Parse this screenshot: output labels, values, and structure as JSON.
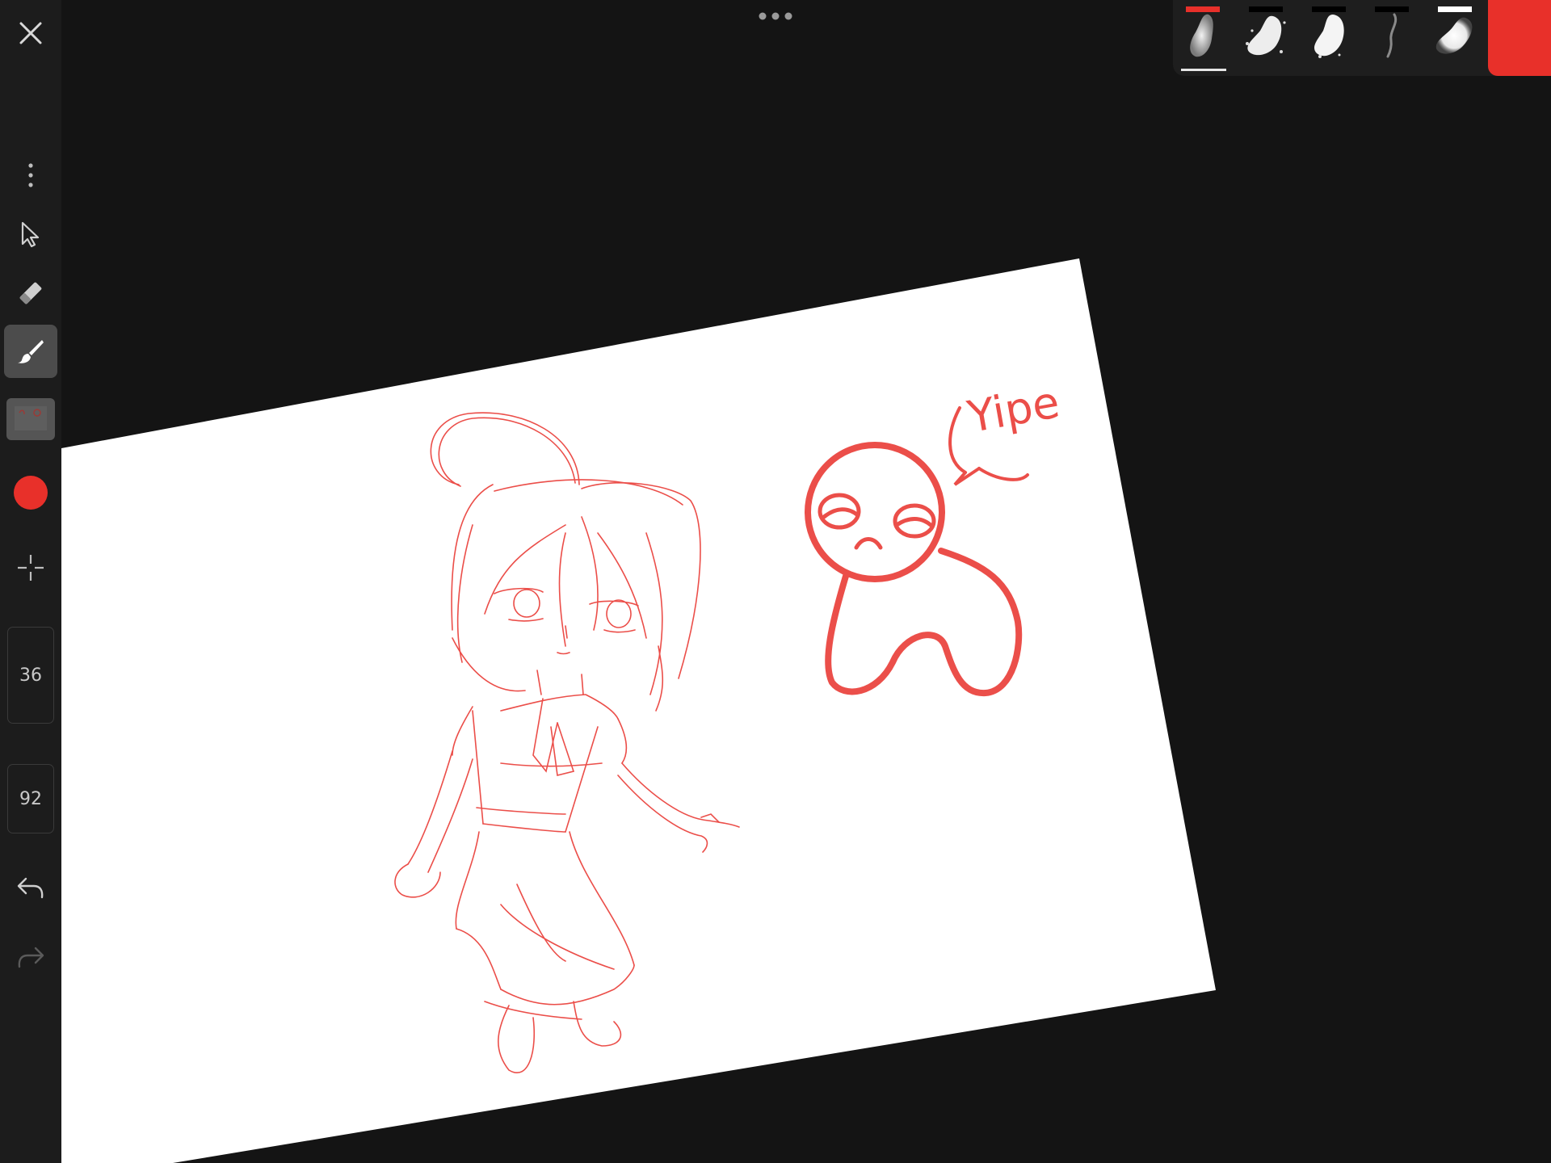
{
  "app": {
    "accent_color": "#e8302a"
  },
  "toolbar": {
    "close_icon": "close-icon",
    "menu_icon": "vertical-dots-icon",
    "tools": [
      "select-arrow-icon",
      "eraser-icon",
      "brush-icon",
      "layers-thumbnail-icon",
      "color-dot-icon",
      "symmetry-crosshair-icon"
    ],
    "active_tool": "brush",
    "brush_size": "36",
    "brush_opacity": "92",
    "undo_icon": "undo-icon",
    "redo_icon": "redo-icon"
  },
  "brushes": [
    {
      "name": "soft-round",
      "selected": true,
      "marker_color": "#e8302a"
    },
    {
      "name": "spray",
      "selected": false,
      "marker_color": "#000000"
    },
    {
      "name": "textured",
      "selected": false,
      "marker_color": "#000000"
    },
    {
      "name": "pencil-line",
      "selected": false,
      "marker_color": "#000000"
    },
    {
      "name": "airbrush",
      "selected": false,
      "marker_color": "#ffffff"
    }
  ],
  "current_color": "#e8302a",
  "sketch": {
    "stroke_color": "#e8302a",
    "speech_text": "Yipe"
  }
}
